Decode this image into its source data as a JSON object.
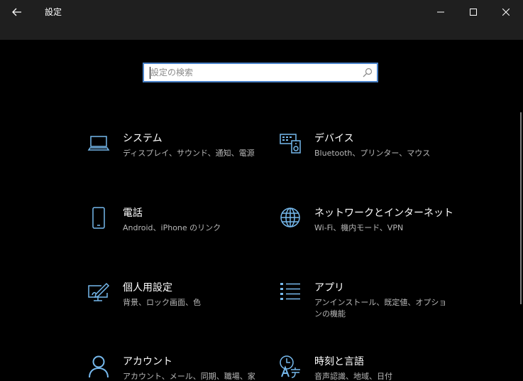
{
  "window": {
    "title": "設定"
  },
  "search": {
    "placeholder": "設定の検索"
  },
  "tiles": [
    {
      "title": "システム",
      "description": "ディスプレイ、サウンド、通知、電源",
      "icon": "laptop-icon"
    },
    {
      "title": "デバイス",
      "description": "Bluetooth、プリンター、マウス",
      "icon": "keyboard-speaker-icon"
    },
    {
      "title": "電話",
      "description": "Android、iPhone のリンク",
      "icon": "phone-icon"
    },
    {
      "title": "ネットワークとインターネット",
      "description": "Wi-Fi、機内モード、VPN",
      "icon": "globe-icon"
    },
    {
      "title": "個人用設定",
      "description": "背景、ロック画面、色",
      "icon": "paint-monitor-icon"
    },
    {
      "title": "アプリ",
      "description": "アンインストール、既定値、オプションの機能",
      "icon": "app-list-icon"
    },
    {
      "title": "アカウント",
      "description": "アカウント、メール、同期、職場、家",
      "icon": "person-icon"
    },
    {
      "title": "時刻と言語",
      "description": "音声認識、地域、日付",
      "icon": "time-language-icon"
    }
  ],
  "colors": {
    "accent": "#76b9ed",
    "background": "#000000",
    "titlebar": "#1f1f1f",
    "search_border": "#4a82c8"
  }
}
